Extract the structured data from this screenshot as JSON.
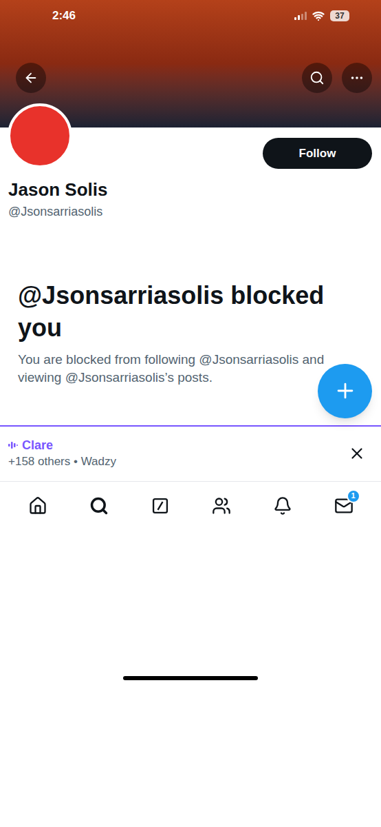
{
  "status_bar": {
    "time": "2:46",
    "battery": "37"
  },
  "profile": {
    "name": "Jason Solis",
    "handle": "@Jsonsarriasolis",
    "follow_button": "Follow"
  },
  "blocked_notice": {
    "title": "@Jsonsarriasolis blocked you",
    "message": "You are blocked from following @Jsonsarriasolis and viewing @Jsonsarriasolis’s posts."
  },
  "space_bar": {
    "host": "Clare",
    "listeners": "+158 others • Wadzy"
  },
  "bottom_nav": [
    {
      "kind": "home",
      "selected": false,
      "badge": ""
    },
    {
      "kind": "search",
      "selected": true,
      "badge": ""
    },
    {
      "kind": "grok",
      "selected": false,
      "badge": ""
    },
    {
      "kind": "communities",
      "selected": false,
      "badge": ""
    },
    {
      "kind": "notifications",
      "selected": false,
      "badge": ""
    },
    {
      "kind": "messages",
      "selected": false,
      "badge": "1"
    }
  ]
}
